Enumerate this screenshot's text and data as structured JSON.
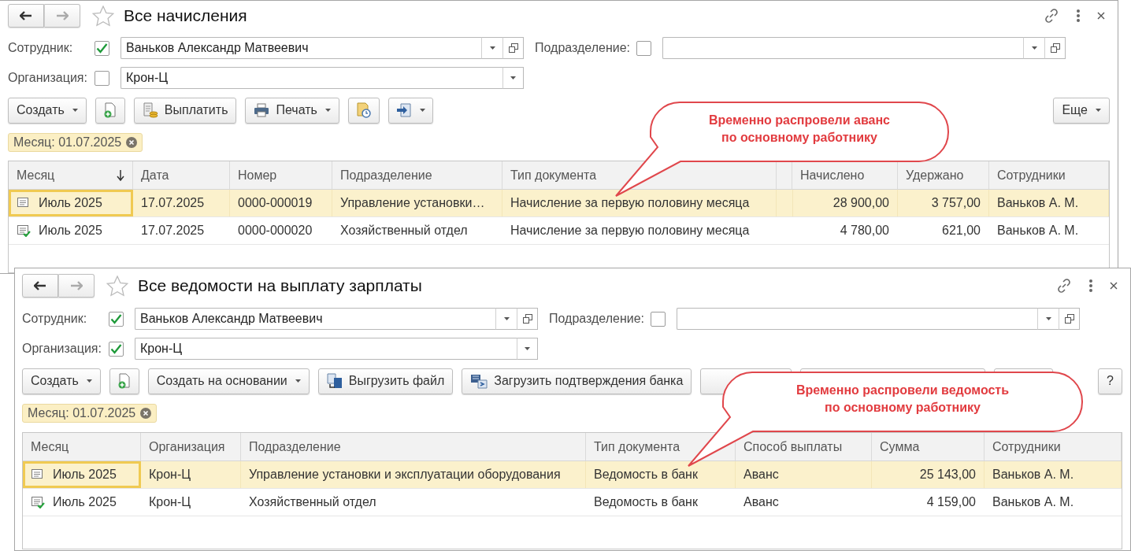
{
  "windows": [
    {
      "title": "Все начисления",
      "nav": {
        "back_enabled": true,
        "forward_enabled": false
      },
      "favorite": false,
      "filters": [
        [
          {
            "label": "Сотрудник:",
            "checked": true,
            "value": "Ваньков Александр Матвеевич",
            "open_button": true
          },
          {
            "label": "Подразделение:",
            "checked": false,
            "open_button": true
          }
        ],
        [
          {
            "label": "Организация:",
            "checked": false,
            "value": "Крон-Ц",
            "open_button": false
          }
        ]
      ],
      "toolbar": {
        "left": [
          {
            "kind": "text",
            "label": "Создать",
            "dropdown": true
          },
          {
            "kind": "add",
            "dropdown": false
          },
          {
            "kind": "pay",
            "label": "Выплатить",
            "dropdown": false
          },
          {
            "kind": "print",
            "label": "Печать",
            "dropdown": true
          },
          {
            "kind": "archive",
            "dropdown": false
          },
          {
            "kind": "send",
            "dropdown": true
          }
        ],
        "right": [
          {
            "kind": "text",
            "label": "Еще",
            "dropdown": true
          }
        ]
      },
      "filter_tags": [
        "Месяц: 01.07.2025"
      ],
      "table": {
        "columns": [
          {
            "title": "Месяц",
            "sorted": true
          },
          {
            "title": "Дата",
            "sorted": false
          },
          {
            "title": "Номер",
            "sorted": false
          },
          {
            "title": "Подразделение",
            "sorted": false
          },
          {
            "title": "Тип документа",
            "sorted": false
          },
          {
            "sorted": false
          },
          {
            "title": "Начислено",
            "sorted": false
          },
          {
            "title": "Удержано",
            "sorted": false
          },
          {
            "title": "Сотрудники",
            "sorted": false
          }
        ],
        "rows": [
          {
            "selected": true,
            "posted": false,
            "cells": [
              "Июль 2025",
              "17.07.2025",
              "0000-000019",
              "Управление установки…",
              "Начисление за первую половину месяца",
              null,
              "28 900,00",
              "3 757,00",
              "Ваньков А. М."
            ]
          },
          {
            "selected": false,
            "posted": true,
            "cells": [
              "Июль 2025",
              "17.07.2025",
              "0000-000020",
              "Хозяйственный отдел",
              "Начисление за первую половину месяца",
              null,
              "4 780,00",
              "621,00",
              "Ваньков А. М."
            ]
          }
        ]
      },
      "callout": "Временно распровели аванс\nпо основному работнику"
    },
    {
      "title": "Все ведомости на выплату зарплаты",
      "nav": {
        "back_enabled": true,
        "forward_enabled": false
      },
      "favorite": false,
      "filters": [
        [
          {
            "label": "Сотрудник:",
            "checked": true,
            "value": "Ваньков Александр Матвеевич",
            "open_button": true
          },
          {
            "label": "Подразделение:",
            "checked": false,
            "open_button": true
          }
        ],
        [
          {
            "label": "Организация:",
            "checked": true,
            "value": "Крон-Ц",
            "open_button": false
          }
        ]
      ],
      "toolbar": {
        "left": [
          {
            "kind": "text",
            "label": "Создать",
            "dropdown": true
          },
          {
            "kind": "add",
            "dropdown": false
          },
          {
            "kind": "text",
            "label": "Создать на основании",
            "dropdown": true
          },
          {
            "kind": "unload",
            "label": "Выгрузить файл",
            "dropdown": false
          },
          {
            "kind": "bankload",
            "label": "Загрузить подтверждения банка",
            "dropdown": false
          },
          {
            "kind": "blank",
            "dropdown": false
          },
          {
            "kind": "blank",
            "dropdown": false
          },
          {
            "kind": "blank",
            "dropdown": false
          }
        ],
        "right": [
          {
            "kind": "text",
            "label": "?",
            "dropdown": false
          }
        ]
      },
      "filter_tags": [
        "Месяц: 01.07.2025"
      ],
      "table": {
        "columns": [
          {
            "title": "Месяц",
            "sorted": false
          },
          {
            "title": "Организация",
            "sorted": false
          },
          {
            "title": "Подразделение",
            "sorted": false
          },
          {
            "title": "Тип документа",
            "sorted": false
          },
          {
            "title": "Способ выплаты",
            "sorted": false
          },
          {
            "title": "Сумма",
            "sorted": false
          },
          {
            "title": "Сотрудники",
            "sorted": false
          }
        ],
        "rows": [
          {
            "selected": true,
            "posted": false,
            "cells": [
              "Июль 2025",
              "Крон-Ц",
              "Управление установки и эксплуатации оборудования",
              "Ведомость в банк",
              "Аванс",
              "25 143,00",
              "Ваньков А. М."
            ]
          },
          {
            "selected": false,
            "posted": true,
            "cells": [
              "Июль 2025",
              "Крон-Ц",
              "Хозяйственный отдел",
              "Ведомость в банк",
              "Аванс",
              "4 159,00",
              "Ваньков А. М."
            ]
          }
        ]
      },
      "callout": "Временно распровели ведомость\nпо основному работнику"
    }
  ]
}
